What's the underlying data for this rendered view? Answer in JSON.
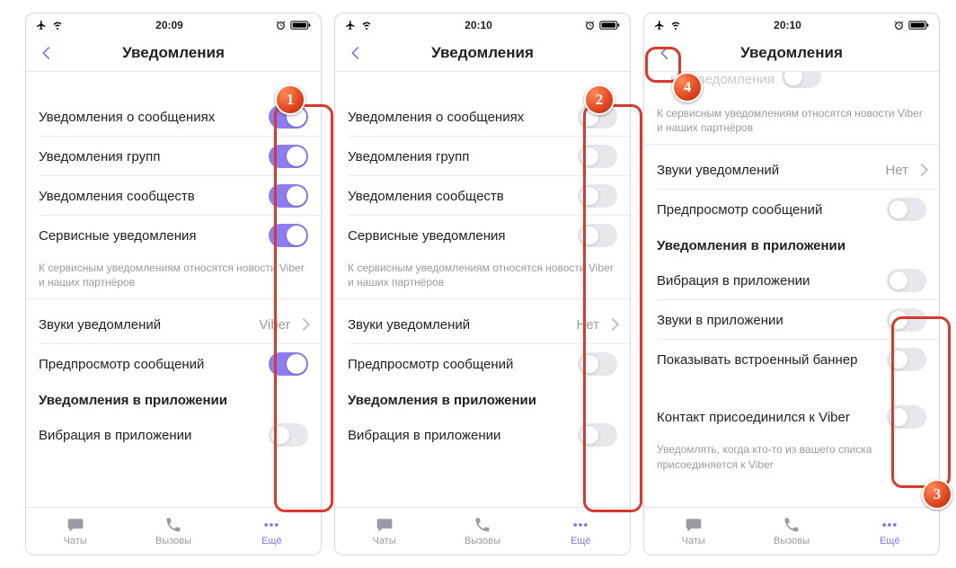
{
  "colors": {
    "accent": "#8472ea",
    "highlight": "#d83a2f"
  },
  "tabs": {
    "chats": "Чаты",
    "calls": "Вызовы",
    "more": "Ещё"
  },
  "p1": {
    "time": "20:09",
    "title": "Уведомления",
    "items": {
      "msg": "Уведомления о сообщениях",
      "group": "Уведомления групп",
      "comm": "Уведомления сообществ",
      "serv": "Сервисные уведомления"
    },
    "footnote": "К сервисным уведомлениям относятся новости Viber и наших партнёров",
    "sounds_label": "Звуки уведомлений",
    "sounds_value": "Viber",
    "preview": "Предпросмотр сообщений",
    "sec_inapp": "Уведомления в приложении",
    "vibr": "Вибрация в приложении",
    "badge": "1"
  },
  "p2": {
    "time": "20:10",
    "title": "Уведомления",
    "items": {
      "msg": "Уведомления о сообщениях",
      "group": "Уведомления групп",
      "comm": "Уведомления сообществ",
      "serv": "Сервисные уведомления"
    },
    "footnote": "К сервисным уведомлениям относятся новости Viber и наших партнёров",
    "sounds_label": "Звуки уведомлений",
    "sounds_value": "Нет",
    "preview": "Предпросмотр сообщений",
    "sec_inapp": "Уведомления в приложении",
    "vibr": "Вибрация в приложении",
    "badge": "2"
  },
  "p3": {
    "time": "20:10",
    "title": "Уведомления",
    "partial_label": "…ые уведомления",
    "footnote1": "К сервисным уведомлениям относятся новости Viber и наших партнёров",
    "sounds_label": "Звуки уведомлений",
    "sounds_value": "Нет",
    "preview": "Предпросмотр сообщений",
    "sec_inapp": "Уведомления в приложении",
    "vibr": "Вибрация в приложении",
    "sounds_inapp": "Звуки в приложении",
    "banner": "Показывать встроенный баннер",
    "contact_joined": "Контакт присоединился к Viber",
    "footnote2": "Уведомлять, когда кто-то из вашего списка присоединяется к Viber",
    "badge_a": "3",
    "badge_b": "4"
  }
}
